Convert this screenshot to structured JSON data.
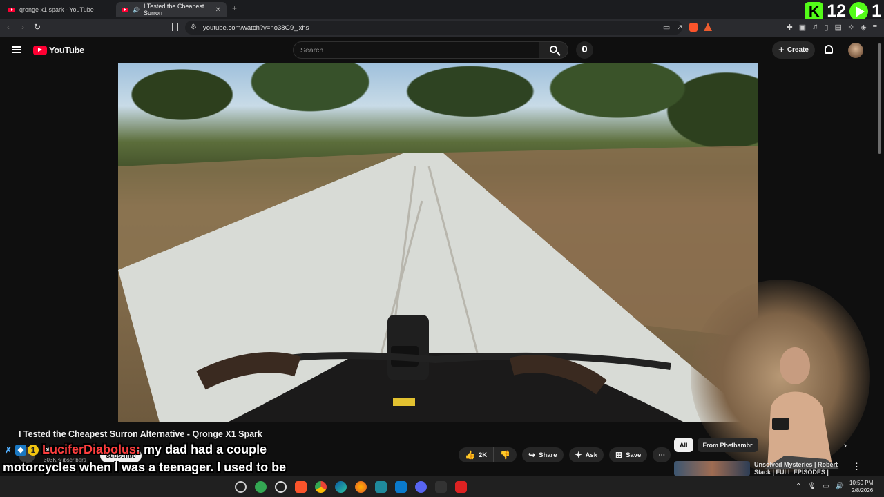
{
  "browser": {
    "tabs": [
      {
        "title": "qronge x1 spark - YouTube",
        "active": false
      },
      {
        "title": "I Tested the Cheapest Surron",
        "active": true
      }
    ],
    "url": "youtube.com/watch?v=no38G9_jxhs"
  },
  "stream_overlay": {
    "kick_letter": "K",
    "count_a": "12",
    "count_b": "1"
  },
  "youtube": {
    "logo_text": "YouTube",
    "search_placeholder": "Search",
    "create_label": "Create"
  },
  "video": {
    "title": "I Tested the Cheapest Surron Alternative - Qronge X1 Spark",
    "channel_name": "Phethambr",
    "subscribers": "303K subscribers",
    "subscribe_label": "Subscribe",
    "likes": "2K",
    "share_label": "Share",
    "ask_label": "Ask",
    "save_label": "Save"
  },
  "sidebar": {
    "chips": [
      "All",
      "From Phethambr"
    ],
    "recommendation_title": "Unsolved Mysteries | Robert Stack | FULL EPISODES |"
  },
  "chat_message": {
    "badge_number": "1",
    "username": "LuciferDiabolus:",
    "text": "my dad had a couple motorcycles when I was a teenager. I used to be obsessed with the Hayabusas lol"
  },
  "taskbar": {
    "time": "10:50 PM",
    "date": "2/8/2026"
  },
  "colors": {
    "youtube_red": "#ff0033",
    "kick_green": "#53fc18",
    "chat_username": "#ff3e3e"
  }
}
